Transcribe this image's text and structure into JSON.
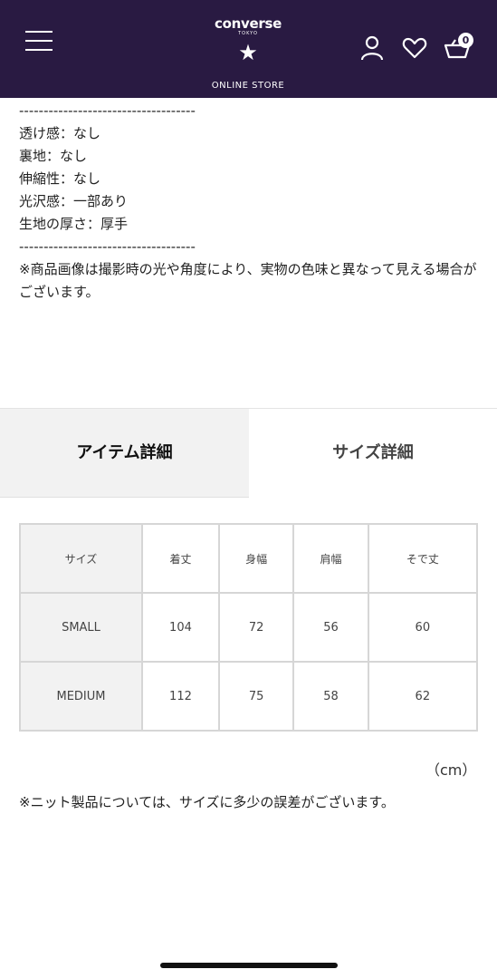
{
  "header": {
    "brand_word": "converse",
    "brand_sub": "TOKYO",
    "store_label": "ONLINE STORE",
    "cart_count": "0",
    "background": "#291a42"
  },
  "description": {
    "divider_top": "------------------------------------",
    "lines": [
      "透け感：なし",
      "裏地：なし",
      "伸縮性：なし",
      "光沢感：一部あり",
      "生地の厚さ：厚手"
    ],
    "divider_bottom": "------------------------------------",
    "disclaimer": "※商品画像は撮影時の光や角度により、実物の色味と異なって見える場合がございます。"
  },
  "tabs": {
    "item_detail": "アイテム詳細",
    "size_detail": "サイズ詳細"
  },
  "size_table": {
    "headers": [
      "サイズ",
      "着丈",
      "身幅",
      "肩幅",
      "そで丈"
    ],
    "rows": [
      [
        "SMALL",
        "104",
        "72",
        "56",
        "60"
      ],
      [
        "MEDIUM",
        "112",
        "75",
        "58",
        "62"
      ]
    ],
    "unit": "（cm）"
  },
  "knit_note": "※ニット製品については、サイズに多少の誤差がございます。"
}
